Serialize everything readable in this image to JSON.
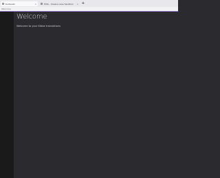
{
  "browser": {
    "tabs": [
      {
        "label": "Kurbanzz",
        "active": true
      },
      {
        "label": "Hilfe - Unsere neue Sandbox",
        "active": false
      }
    ],
    "new_tab_label": "+",
    "close_label": "×",
    "url": "Welcome"
  },
  "page": {
    "title": "Welcome",
    "subtitle": "Welcome to your Kibbe translations"
  },
  "colors": {
    "background": "#2b2a2e",
    "sidebar": "#1a1a1a",
    "accent": "#8e76c8"
  }
}
